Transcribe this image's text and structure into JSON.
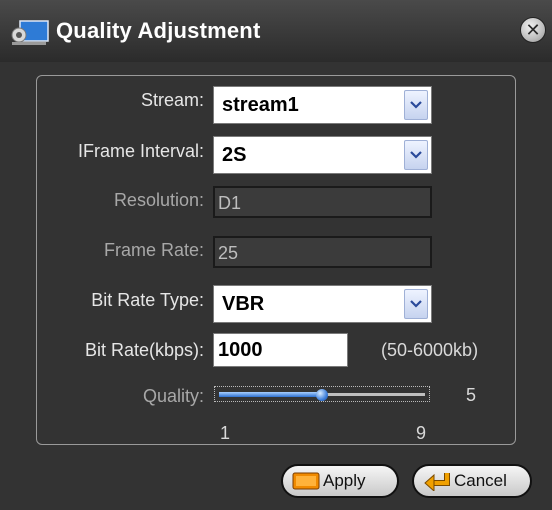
{
  "window": {
    "title": "Quality Adjustment"
  },
  "fields": {
    "stream": {
      "label": "Stream:",
      "value": "stream1"
    },
    "iframe_interval": {
      "label": "IFrame Interval:",
      "value": "2S"
    },
    "resolution": {
      "label": "Resolution:",
      "value": "D1"
    },
    "frame_rate": {
      "label": "Frame Rate:",
      "value": "25"
    },
    "bit_rate_type": {
      "label": "Bit Rate Type:",
      "value": "VBR"
    },
    "bit_rate": {
      "label": "Bit Rate(kbps):",
      "value": "1000",
      "range": "(50-6000kb)"
    },
    "quality": {
      "label": "Quality:",
      "value": "5",
      "min": "1",
      "max": "9",
      "level": 5
    }
  },
  "buttons": {
    "apply": "Apply",
    "cancel": "Cancel"
  },
  "icons": {
    "app": "film-camera-icon",
    "close": "close-icon",
    "dropdown": "chevron-down-icon",
    "apply": "apply-icon",
    "cancel": "return-arrow-icon"
  },
  "colors": {
    "accent": "#2d6fd0",
    "apply_icon": "#f08a00",
    "cancel_icon": "#f0a000"
  }
}
